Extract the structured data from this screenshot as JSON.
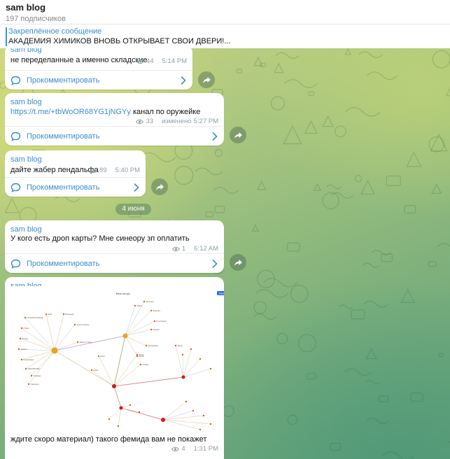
{
  "header": {
    "title": "sam blog",
    "subscribers": "197 подписчиков"
  },
  "pinned": {
    "label": "Закреплённое сообщение",
    "text": "АКАДЕМИЯ ХИМИКОВ ВНОВЬ ОТКРЫВАЕТ СВОИ ДВЕРИ!..."
  },
  "comment_label": "Прокомментировать",
  "date_separator": "4 июня",
  "messages": [
    {
      "author": "sam blog",
      "text": "не переделанные а именно складские",
      "views": "44",
      "time": "5:14 PM"
    },
    {
      "author": "sam blog",
      "link": "https://t.me/+tbWoOR68YG1jNGYy",
      "text_after": " канал по оружейке",
      "views": "33",
      "edited": "изменено",
      "time": "5:27 PM"
    },
    {
      "author": "sam blog",
      "text": "дайте жабер пендальфа",
      "views": "89",
      "time": "5:40 PM"
    },
    {
      "author": "sam blog",
      "text": "У кого есть дроп карты? Мне синеору зп оплатить",
      "views": "1",
      "time": "6:12 AM"
    },
    {
      "author": "sam blog",
      "text": "ждите скоро материал) такого фемида вам не покажет",
      "views": "4",
      "time": "1:31 PM",
      "image": {
        "toolbar_label": "Best shops",
        "button_label": "Save",
        "node_labels": [
          "LOGISTICS BASE",
          "Отдел",
          "Склад",
          "Армия",
          "Кладовщик",
          "WHITEROSE",
          "Граница",
          "Жив",
          "Военный",
          "Ammo Factory",
          "Weapon Shop",
          "Гарнизон",
          "Арсенал",
          "Закупка",
          "Fort Supply",
          "Ремонт",
          "Оружейник",
          "Штаб",
          "Alpha",
          "Bravo",
          "Charlie",
          "Delta",
          "Echo",
          "Tango"
        ]
      }
    }
  ],
  "colors": {
    "accent": "#3a8ed0",
    "bubble": "#ffffff",
    "meta": "#8fa0a8",
    "node_orange": "#f0a020",
    "node_red": "#d01818",
    "node_small": "#e85c1c"
  }
}
